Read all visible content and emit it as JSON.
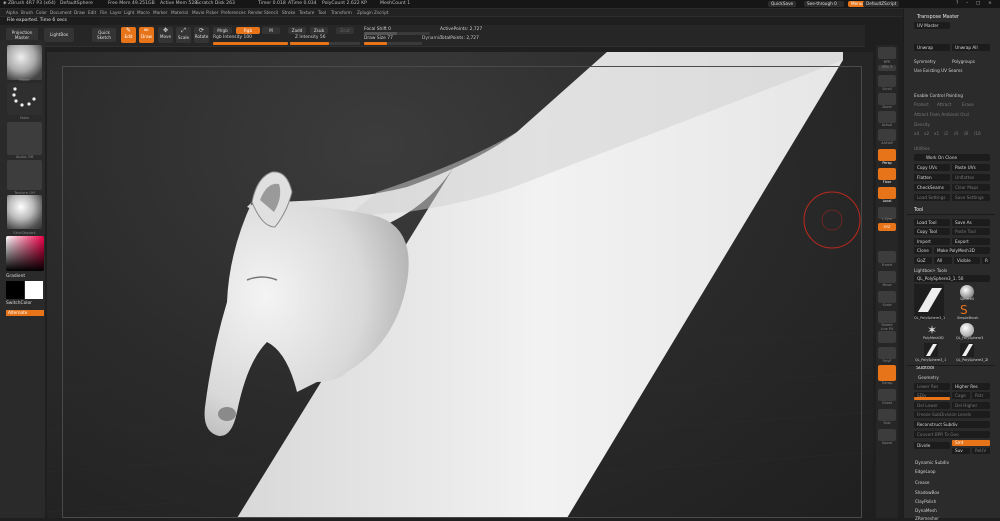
{
  "titlebar": {
    "segments": [
      "ZBrush 4R7 P3 (x64)",
      "DefaultSphere",
      "Free Mem 49.251GB",
      "Active Mem 528",
      "Scratch Disk 263",
      "Timer 0.018",
      "ATime 0.034",
      "PolyCount 2.622 KP",
      "MeshCount 1"
    ],
    "quicksave": "QuickSave",
    "seethrough": "See-through 0",
    "menus_btn": "Menus",
    "script": "DefaultZScript"
  },
  "menubar": [
    "Alpha",
    "Brush",
    "Color",
    "Document",
    "Draw",
    "Edit",
    "File",
    "Layer",
    "Light",
    "Macro",
    "Marker",
    "Material",
    "Movie",
    "Picker",
    "Preferences",
    "Render",
    "Stencil",
    "Stroke",
    "Texture",
    "Tool",
    "Transform",
    "Zplugin",
    "Zscript"
  ],
  "notice": "File exported. Time 6 secs",
  "toolbar": {
    "projection_master": "Projection Master",
    "lightbox": "LightBox",
    "quick_sketch": "Quick Sketch",
    "edit": "Edit",
    "draw": "Draw",
    "move": "Move",
    "scale": "Scale",
    "rotate": "Rotate",
    "mrgb": "Mrgb",
    "rgb": "Rgb",
    "m": "M",
    "zadd": "Zadd",
    "zsub": "Zsub",
    "zcut": "Zcut",
    "rgb_intensity": "Rgb Intensity 100",
    "z_intensity": "Z Intensity 56",
    "focal_shift": "Focal Shift 0",
    "draw_size": "Draw Size 77",
    "dynamic": "Dynamic",
    "active_points": "ActivePoints: 2,727",
    "total_points": "TotalPoints: 2,727"
  },
  "lefttray": {
    "brush_label": "Move",
    "stroke_label": "Dots",
    "alpha_label": "Alpha Off",
    "texture_label": "Texture Off",
    "material_label": "SkinShade4",
    "gradient": "Gradient",
    "switch_color": "SwitchColor",
    "alternate": "Alternate"
  },
  "righticons": [
    "BPR",
    "SPix 3",
    "Scroll",
    "Zoom",
    "Actual",
    "AAHalf",
    "Persp",
    "Floor",
    "Local",
    "L.Sym",
    "XYZ",
    "Frame",
    "Move",
    "Scale",
    "Rotate",
    "Line Fill",
    "PolyF",
    "Transp",
    "Ghost",
    "Solo",
    "Xpose"
  ],
  "rightpanel": {
    "transpose_master": "Transpose Master",
    "uv_master": "UV Master",
    "unwrap": "Unwrap",
    "unwrap_all": "Unwrap All",
    "symmetry": "Symmetry",
    "polygroups": "Polygroups",
    "use_existing_uv": "Use Existing UV Seams",
    "enable_control_painting": "Enable Control Painting",
    "protect": "Protect",
    "attract": "Attract",
    "erase": "Erase",
    "attract_from_ambient": "Attract From Ambient Occl",
    "density": "Density",
    "density_values": [
      "x4",
      "x2",
      "x1",
      "/2",
      "/4",
      "/8",
      "/16"
    ],
    "utilities": "Utilities",
    "work_on_clone": "Work On Clone",
    "copy_uvs": "Copy UVs",
    "paste_uvs": "Paste UVs",
    "flatten": "Flatten",
    "unflatten": "Unflatten",
    "check_seams": "CheckSeams",
    "clear_maps": "Clear Maps",
    "load_settings": "Load Settings",
    "save_settings": "Save Settings",
    "tool_header": "Tool",
    "load_tool": "Load Tool",
    "save_as": "Save As",
    "copy_tool": "Copy Tool",
    "paste_tool": "Paste Tool",
    "import": "Import",
    "export": "Export",
    "clone": "Clone",
    "make_polymesh": "Make PolyMesh3D",
    "goz": "GoZ",
    "all": "All",
    "visible": "Visible",
    "r": "R",
    "lightbox_tools": "Lightbox> Tools",
    "current_tool": "QL_PolySphere3_1. 50",
    "tool_names": [
      "QL_PolySphere3_1",
      "SphereS",
      "SimpleBrush",
      "PolyMesh3D",
      "QL_PolySphere3",
      "QL_PolySphere3_1",
      "QL_PolySphere3_2"
    ],
    "tool_number": "2",
    "subtool": "Subtool",
    "geometry": "Geometry",
    "lower_res": "Lower Res",
    "higher_res": "Higher Res",
    "sdiv": "SDiv",
    "cage": "Cage",
    "rstr": "Rstr",
    "del_lower": "Del Lower",
    "del_higher": "Del Higher",
    "freeze_subdivision": "Freeze SubDivision Levels",
    "reconstruct_subdiv": "Reconstruct Subdiv",
    "convert_bpr": "Convert BPR To Geo",
    "divide": "Divide",
    "smt": "Smt",
    "suv": "Suv",
    "reuv": "ReUV",
    "dynamic_subdiv": "Dynamic Subdiv",
    "edge_loop": "EdgeLoop",
    "crease": "Crease",
    "shadow_box": "ShadowBox",
    "clay_polish": "ClayPolish",
    "dyna_mesh": "DynaMesh",
    "zremesher": "ZRemesher"
  }
}
